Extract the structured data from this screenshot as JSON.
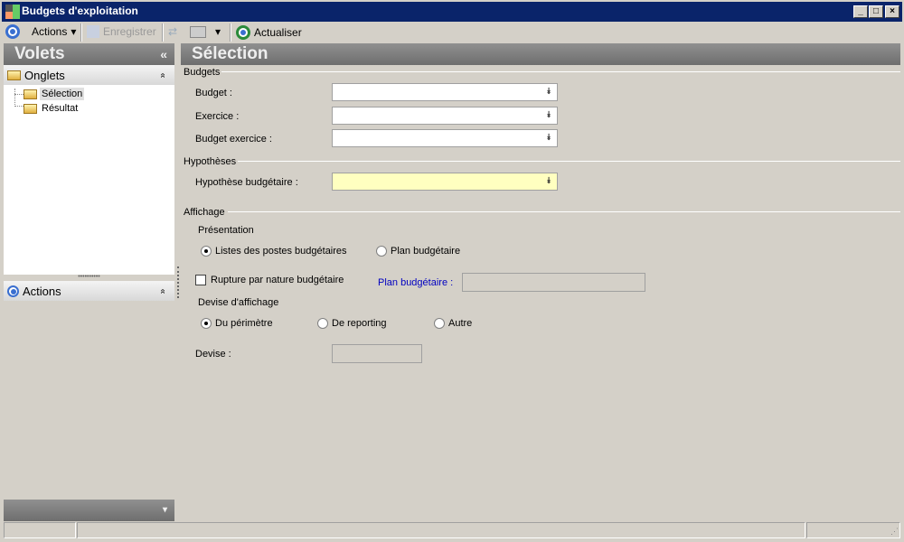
{
  "window": {
    "title": "Budgets d'exploitation"
  },
  "toolbar": {
    "actions": "Actions",
    "save": "Enregistrer",
    "refresh": "Actualiser"
  },
  "left": {
    "title": "Volets",
    "collapse": "«",
    "onglets": "Onglets",
    "tree": [
      "Sélection",
      "Résultat"
    ],
    "actions": "Actions",
    "up": "»"
  },
  "main": {
    "title": "Sélection",
    "budgets": {
      "section": "Budgets",
      "budget": "Budget :",
      "exercice": "Exercice :",
      "budget_exercice": "Budget exercice :"
    },
    "hypotheses": {
      "section": "Hypothèses",
      "hypothese": "Hypothèse budgétaire :"
    },
    "affichage": {
      "section": "Affichage",
      "presentation": "Présentation",
      "opt_listes": "Listes des postes budgétaires",
      "opt_plan": "Plan budgétaire",
      "rupture": "Rupture par nature budgétaire",
      "plan_label": "Plan budgétaire :",
      "devise_affichage": "Devise d'affichage",
      "opt_perimetre": "Du périmètre",
      "opt_reporting": "De reporting",
      "opt_autre": "Autre",
      "devise": "Devise :"
    }
  },
  "colors": {
    "title_bar": "#0a246a",
    "highlight": "#ffffc0",
    "link_label": "#0000c0"
  }
}
